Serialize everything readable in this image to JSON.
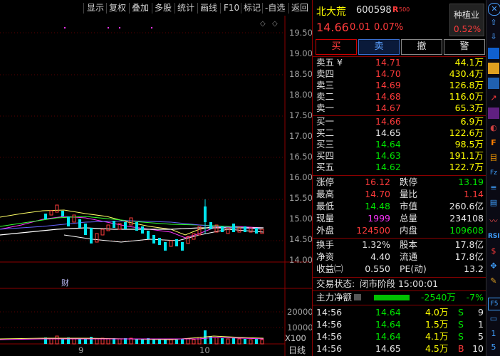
{
  "toolbar": {
    "items": [
      "显示",
      "复权",
      "叠加",
      "多股",
      "统计",
      "画线",
      "F10",
      "标记",
      "-自选",
      "返回"
    ]
  },
  "chart": {
    "price_ticks": [
      "19.50",
      "19.00",
      "18.50",
      "18.00",
      "17.50",
      "17.00",
      "16.50",
      "16.00",
      "15.50",
      "15.00",
      "14.50",
      "14.00"
    ],
    "vol_ticks": [
      "20000",
      "10000"
    ],
    "vol_unit": "X100",
    "date_labels": [
      "9",
      "10"
    ],
    "period_label": "日线",
    "finance_mark": "财"
  },
  "header": {
    "name": "北大荒",
    "code": "600598",
    "badge": "R",
    "badge_sub": "500",
    "industry": "种植业",
    "industry_change": "0.52%",
    "price": "14.66",
    "change": "0.01",
    "change_pct": "0.07%"
  },
  "trade_buttons": {
    "buy": "买",
    "sell": "卖",
    "cancel": "撤",
    "alert": "警"
  },
  "asks": [
    {
      "label": "卖五 ¥",
      "price": "14.71",
      "vol": "44.1万"
    },
    {
      "label": "卖四",
      "price": "14.70",
      "vol": "430.4万"
    },
    {
      "label": "卖三",
      "price": "14.69",
      "vol": "126.8万"
    },
    {
      "label": "卖二",
      "price": "14.68",
      "vol": "116.0万"
    },
    {
      "label": "卖一",
      "price": "14.67",
      "vol": "65.3万"
    }
  ],
  "bids": [
    {
      "label": "买一",
      "price": "14.66",
      "vol": "6.9万"
    },
    {
      "label": "买二",
      "price": "14.65",
      "vol": "122.6万"
    },
    {
      "label": "买三",
      "price": "14.64",
      "vol": "98.5万"
    },
    {
      "label": "买四",
      "price": "14.63",
      "vol": "191.1万"
    },
    {
      "label": "买五",
      "price": "14.62",
      "vol": "122.7万"
    }
  ],
  "stats1": [
    {
      "l1": "涨停",
      "v1": "16.12",
      "l2": "跌停",
      "v2": "13.19"
    },
    {
      "l1": "最高",
      "v1": "14.70",
      "l2": "量比",
      "v2": "1.14"
    },
    {
      "l1": "最低",
      "v1": "14.48",
      "l2": "市值",
      "v2": "260.6亿"
    },
    {
      "l1": "现量",
      "v1": "1999",
      "l2": "总量",
      "v2": "234108"
    },
    {
      "l1": "外盘",
      "v1": "124500",
      "l2": "内盘",
      "v2": "109608"
    }
  ],
  "stats2": [
    {
      "l1": "换手",
      "v1": "1.32%",
      "l2": "股本",
      "v2": "17.8亿"
    },
    {
      "l1": "净资",
      "v1": "4.40",
      "l2": "流通",
      "v2": "17.8亿"
    },
    {
      "l1": "收益㈡",
      "v1": "0.550",
      "l2": "PE(动)",
      "v2": "13.2"
    }
  ],
  "status": {
    "label": "交易状态:",
    "value": "闭市阶段 15:00:01"
  },
  "main_flow": {
    "label": "主力净额",
    "value": "-2540万",
    "pct": "-7%"
  },
  "ticks": [
    {
      "time": "14:56",
      "price": "14.64",
      "vol": "4.0万",
      "side": "S",
      "n": "9"
    },
    {
      "time": "14:56",
      "price": "14.64",
      "vol": "1.5万",
      "side": "S",
      "n": "1"
    },
    {
      "time": "14:56",
      "price": "14.64",
      "vol": "4.1万",
      "side": "S",
      "n": "5"
    },
    {
      "time": "14:56",
      "price": "14.65",
      "vol": "4.5万",
      "side": "B",
      "n": "10"
    }
  ],
  "sidebar_numbers": [
    "1",
    "5"
  ]
}
